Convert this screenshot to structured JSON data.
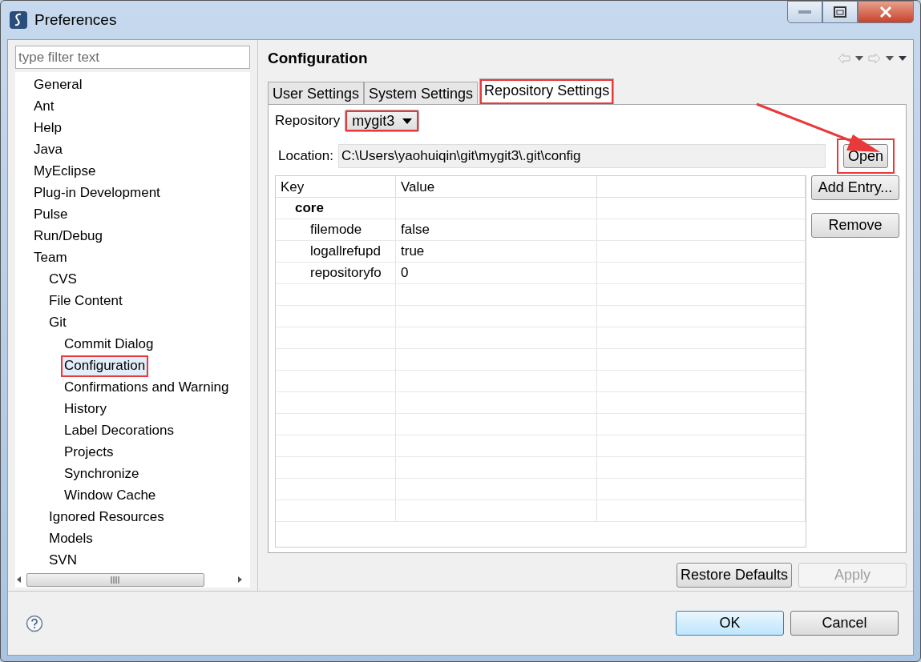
{
  "window": {
    "title": "Preferences"
  },
  "filter": {
    "placeholder": "type filter text"
  },
  "tree": [
    {
      "label": "General",
      "selected": false
    },
    {
      "label": "Ant",
      "selected": false
    },
    {
      "label": "Help",
      "selected": false
    },
    {
      "label": "Java",
      "selected": false
    },
    {
      "label": "MyEclipse",
      "selected": false
    },
    {
      "label": "Plug-in Development",
      "selected": false
    },
    {
      "label": "Pulse",
      "selected": false
    },
    {
      "label": "Run/Debug",
      "selected": false
    },
    {
      "label": "Team",
      "selected": false,
      "children": [
        {
          "label": "CVS",
          "selected": false
        },
        {
          "label": "File Content",
          "selected": false
        },
        {
          "label": "Git",
          "selected": false,
          "children": [
            {
              "label": "Commit Dialog",
              "selected": false
            },
            {
              "label": "Configuration",
              "selected": true,
              "highlighted": true
            },
            {
              "label": "Confirmations and Warning",
              "selected": false
            },
            {
              "label": "History",
              "selected": false
            },
            {
              "label": "Label Decorations",
              "selected": false
            },
            {
              "label": "Projects",
              "selected": false
            },
            {
              "label": "Synchronize",
              "selected": false
            },
            {
              "label": "Window Cache",
              "selected": false
            }
          ]
        },
        {
          "label": "Ignored Resources",
          "selected": false
        },
        {
          "label": "Models",
          "selected": false
        },
        {
          "label": "SVN",
          "selected": false
        }
      ]
    }
  ],
  "page": {
    "title": "Configuration"
  },
  "tabs": [
    {
      "label": "User Settings",
      "selected": false
    },
    {
      "label": "System Settings",
      "selected": false
    },
    {
      "label": "Repository Settings",
      "selected": true,
      "highlighted": true
    }
  ],
  "repository": {
    "label": "Repository",
    "value": "mygit3",
    "highlighted": true
  },
  "location": {
    "label": "Location:",
    "value": "C:\\Users\\yaohuiqin\\git\\mygit3\\.git\\config"
  },
  "open_button": {
    "label": "Open",
    "highlighted": true
  },
  "annotation_arrow": true,
  "table": {
    "columns": [
      "Key",
      "Value"
    ],
    "rows": [
      {
        "key": "core",
        "children": [
          {
            "key": "filemode",
            "value": "false"
          },
          {
            "key": "logallrefupd",
            "value": "true"
          },
          {
            "key": "repositoryfo",
            "value": "0"
          }
        ]
      }
    ]
  },
  "side_buttons": [
    "Add Entry...",
    "Remove"
  ],
  "page_buttons": [
    {
      "label": "Restore Defaults",
      "disabled": false
    },
    {
      "label": "Apply",
      "disabled": true
    }
  ],
  "dialog_buttons": [
    {
      "label": "OK",
      "default": true
    },
    {
      "label": "Cancel",
      "default": false
    }
  ]
}
